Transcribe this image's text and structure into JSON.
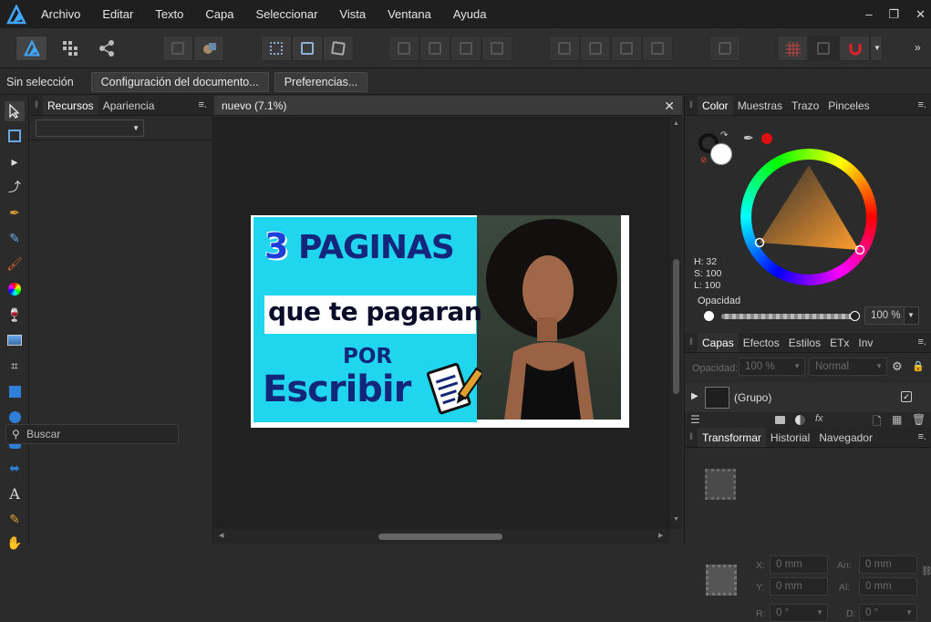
{
  "menu": {
    "items": [
      "Archivo",
      "Editar",
      "Texto",
      "Capa",
      "Seleccionar",
      "Vista",
      "Ventana",
      "Ayuda"
    ],
    "window_controls": [
      "–",
      "❐",
      "✕"
    ]
  },
  "context_bar": {
    "selection": "Sin selección",
    "doc_setup": "Configuración del documento...",
    "preferences": "Preferencias..."
  },
  "left_panel": {
    "tabs": [
      "Recursos",
      "Apariencia"
    ],
    "search_placeholder": "Buscar"
  },
  "document": {
    "tab_title": "nuevo (7.1%)",
    "artwork": {
      "number": "3",
      "line1": "PAGINAS",
      "line2": "que te pagaran",
      "line3": "POR",
      "line4": "Escribir"
    }
  },
  "color_panel": {
    "tabs": [
      "Color",
      "Muestras",
      "Trazo",
      "Pinceles"
    ],
    "h": "H: 32",
    "s": "S: 100",
    "l": "L: 100",
    "opacity_label": "Opacidad",
    "opacity_value": "100 %"
  },
  "layers_panel": {
    "tabs": [
      "Capas",
      "Efectos",
      "Estilos",
      "ETx",
      "Inv"
    ],
    "opacity_label": "Opacidad:",
    "opacity_value": "100 %",
    "blend_mode": "Normal",
    "layer_name": "(Grupo)"
  },
  "transform_panel": {
    "tabs": [
      "Transformar",
      "Historial",
      "Navegador"
    ],
    "x_label": "X:",
    "x_value": "0 mm",
    "y_label": "Y:",
    "y_value": "0 mm",
    "w_label": "An:",
    "w_value": "0 mm",
    "h_label": "Al:",
    "h_value": "0 mm",
    "r_label": "R:",
    "r_value": "0 °",
    "s_label": "D:",
    "s_value": "0 °"
  },
  "colors": {
    "accent_red": "#e01010",
    "artwork_cyan": "#1fd6ee",
    "artwork_navy": "#13267a"
  }
}
